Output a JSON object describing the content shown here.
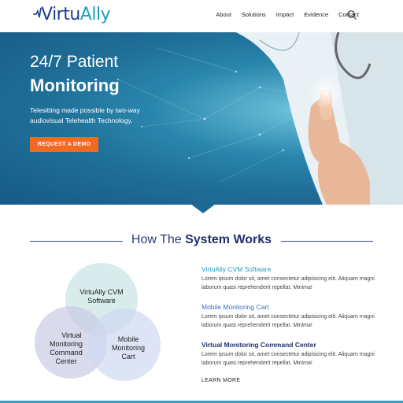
{
  "brand": {
    "name_part1": "Virtu",
    "name_part2": "Ally"
  },
  "nav": {
    "items": [
      {
        "label": "About"
      },
      {
        "label": "Solutions"
      },
      {
        "label": "Impact"
      },
      {
        "label": "Evidence"
      },
      {
        "label": "Contact"
      }
    ],
    "search_icon": "search-icon"
  },
  "hero": {
    "title_line1": "24/7 Patient",
    "title_line2": "Monitoring",
    "subtitle": "Telesitting made possible by two-way audiovisual Telehealth Technology.",
    "cta_label": "REQUEST A DEMO"
  },
  "section": {
    "title_light": "How The ",
    "title_bold": "System Works"
  },
  "venn": {
    "top": [
      "VirtuAlly CVM",
      "Software"
    ],
    "left": [
      "Virtual",
      "Monitoring",
      "Command",
      "Center"
    ],
    "right": [
      "Mobile",
      "Monitoring",
      "Cart"
    ]
  },
  "features": [
    {
      "title": "VirtuAlly CVM Software",
      "body": "Lorem ipsum dolor sit, amet consectetur adipisicing elit. Aliquam magni laborum quasi reprehenderit repellat. Minima!",
      "color": "#1b9fb8"
    },
    {
      "title": "Mobile Monitoring Cart",
      "body": "Lorem ipsum dolor sit, amet consectetur adipisicing elit. Aliquam magni laborum quasi reprehenderit repellat. Minima!",
      "color": "#3b6fc4"
    },
    {
      "title": "Virtual Monitoring Command Center",
      "body": "Lorem ipsum dolor sit, amet consectetur adipisicing elit. Aliquam magni laborum quasi reprehenderit repellat. Minima!",
      "color": "#1f2f6b"
    }
  ],
  "learn_more": "LEARN MORE",
  "colors": {
    "accent_orange": "#f26a21",
    "brand_navy": "#1f2f6b",
    "brand_teal": "#1b9fb8"
  }
}
